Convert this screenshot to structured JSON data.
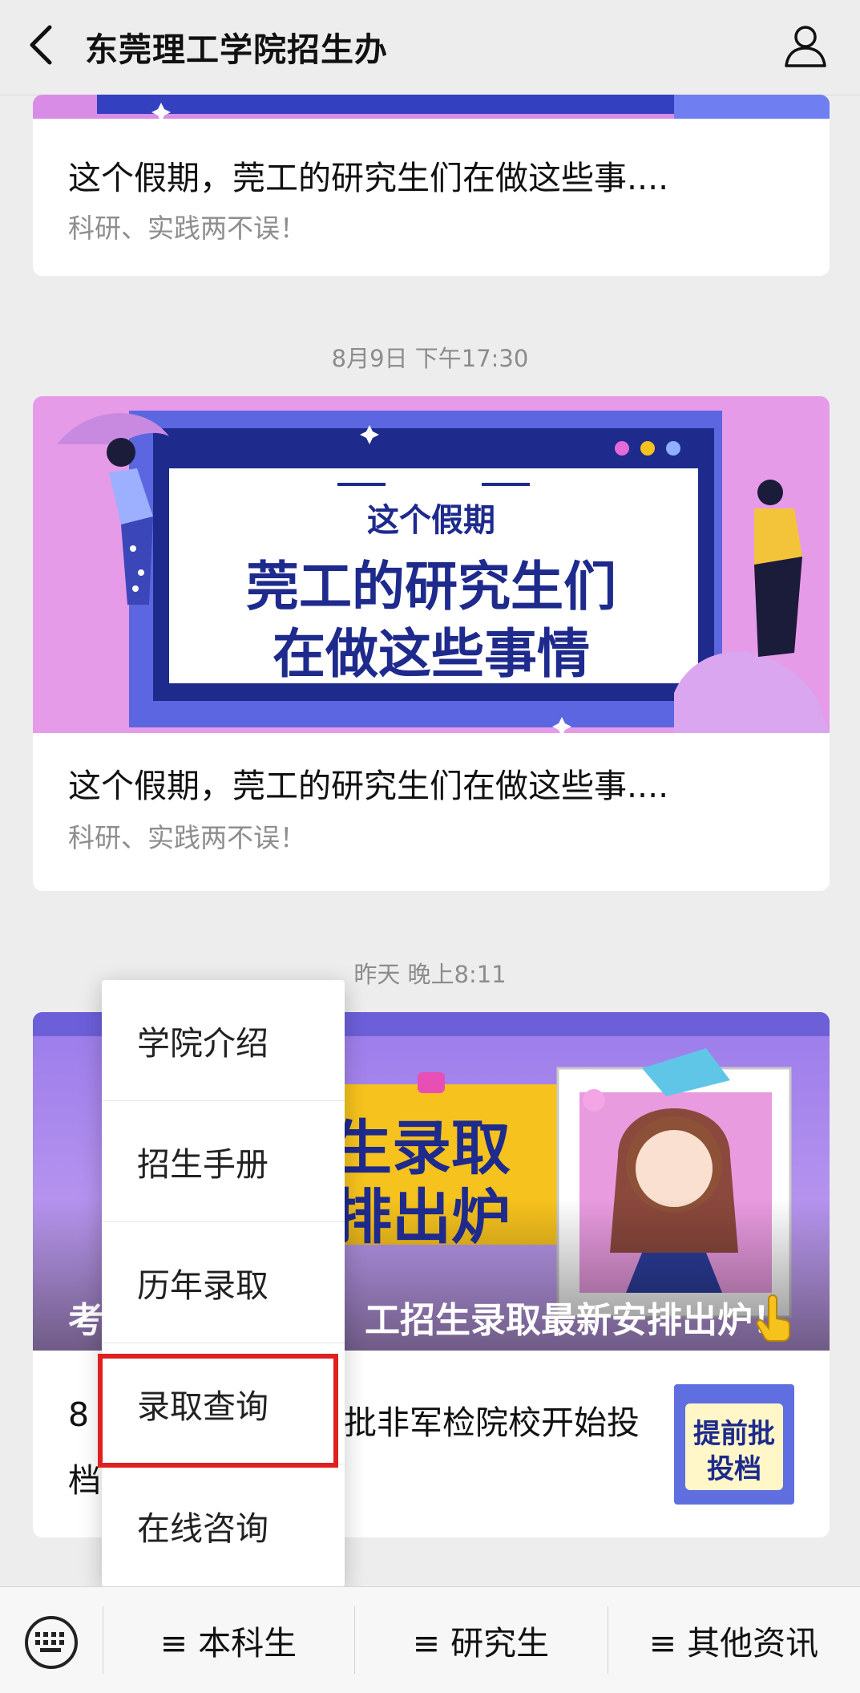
{
  "header": {
    "title": "东莞理工学院招生办"
  },
  "articles": [
    {
      "title": "这个假期，莞工的研究生们在做这些事....",
      "subtitle": "科研、实践两不误！"
    },
    {
      "timestamp": "8月9日 下午17:30",
      "banner_line1": "这个假期",
      "banner_line2": "莞工的研究生们",
      "banner_line3": "在做这些事情",
      "title": "这个假期，莞工的研究生们在做这些事....",
      "subtitle": "科研、实践两不误！"
    },
    {
      "timestamp": "昨天 晚上8:11",
      "banner_text1": "招生录取",
      "banner_text2": "安排出炉",
      "overlay_left": "考",
      "overlay_right": "工招生录取最新安排出炉！",
      "sub_left1": "8",
      "sub_right": "批非军检院校开始投",
      "sub_left2": "档",
      "thumb_line1": "提前批",
      "thumb_line2": "投档"
    }
  ],
  "menu": {
    "items": [
      "学院介绍",
      "招生手册",
      "历年录取",
      "录取查询",
      "在线咨询"
    ],
    "highlighted": "录取查询"
  },
  "bottom_bar": {
    "tabs": [
      "≡ 本科生",
      "≡ 研究生",
      "≡ 其他资讯"
    ]
  },
  "colors": {
    "highlight": "#e02020",
    "banner_navy": "#1e2a8c",
    "banner_yellow": "#f6c21d"
  }
}
